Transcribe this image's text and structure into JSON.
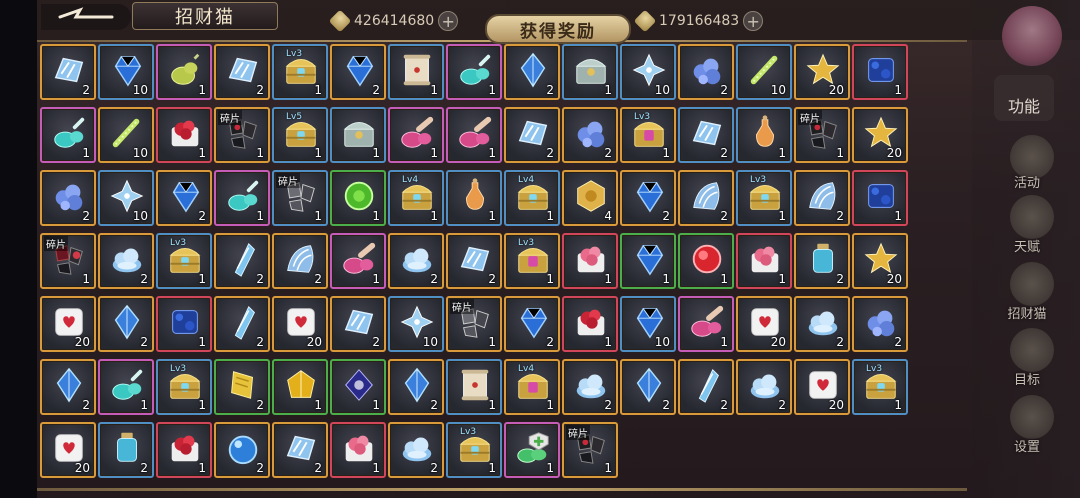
{
  "header": {
    "title": "招财猫",
    "currency_1": "426414680",
    "currency_2": "179166483",
    "reward_title": "获得奖励",
    "plus": "+"
  },
  "side_menu": {
    "function_label": "功能",
    "items": [
      {
        "label": "活动",
        "icon": "activity-emblem-icon"
      },
      {
        "label": "天赋",
        "icon": "talent-emblem-icon"
      },
      {
        "label": "招财猫",
        "icon": "lucky-cat-icon"
      },
      {
        "label": "目标",
        "icon": "target-icon"
      },
      {
        "label": "设置",
        "icon": "gear-icon"
      }
    ]
  },
  "rewards": [
    {
      "icon": "ice-crystal",
      "qty": "2",
      "rarity": "orange"
    },
    {
      "icon": "blue-gem",
      "qty": "10",
      "rarity": "blue"
    },
    {
      "icon": "potion-green",
      "qty": "1",
      "rarity": "purple"
    },
    {
      "icon": "ice-crystal",
      "qty": "2",
      "rarity": "orange"
    },
    {
      "icon": "chest",
      "qty": "1",
      "rarity": "blue",
      "lv": "Lv3"
    },
    {
      "icon": "blue-gem",
      "qty": "2",
      "rarity": "orange"
    },
    {
      "icon": "scroll",
      "qty": "1",
      "rarity": "blue"
    },
    {
      "icon": "potion-cyan",
      "qty": "1",
      "rarity": "purple"
    },
    {
      "icon": "blue-crystal",
      "qty": "2",
      "rarity": "orange"
    },
    {
      "icon": "chest-silver",
      "qty": "1",
      "rarity": "blue"
    },
    {
      "icon": "sparkle-crystal",
      "qty": "10",
      "rarity": "blue"
    },
    {
      "icon": "ore-blue",
      "qty": "2",
      "rarity": "orange"
    },
    {
      "icon": "wand",
      "qty": "10",
      "rarity": "blue"
    },
    {
      "icon": "star",
      "qty": "20",
      "rarity": "orange"
    },
    {
      "icon": "ore-dark",
      "qty": "1",
      "rarity": "red"
    },
    {
      "icon": "potion-cyan",
      "qty": "1",
      "rarity": "purple"
    },
    {
      "icon": "wand",
      "qty": "10",
      "rarity": "orange"
    },
    {
      "icon": "ore-red",
      "qty": "1",
      "rarity": "red"
    },
    {
      "icon": "shard-dark",
      "qty": "1",
      "rarity": "orange",
      "tag": "碎片"
    },
    {
      "icon": "chest",
      "qty": "1",
      "rarity": "blue",
      "lv": "Lv5"
    },
    {
      "icon": "chest-silver",
      "qty": "1",
      "rarity": "blue"
    },
    {
      "icon": "potion-pink",
      "qty": "1",
      "rarity": "purple"
    },
    {
      "icon": "potion-pink",
      "qty": "1",
      "rarity": "purple"
    },
    {
      "icon": "ice-crystal",
      "qty": "2",
      "rarity": "orange"
    },
    {
      "icon": "ore-blue",
      "qty": "2",
      "rarity": "orange"
    },
    {
      "icon": "chest-pink",
      "qty": "1",
      "rarity": "orange",
      "lv": "Lv3"
    },
    {
      "icon": "ice-crystal",
      "qty": "2",
      "rarity": "blue"
    },
    {
      "icon": "potion-orange",
      "qty": "1",
      "rarity": "blue"
    },
    {
      "icon": "shard-dark",
      "qty": "1",
      "rarity": "orange",
      "tag": "碎片"
    },
    {
      "icon": "star",
      "qty": "20",
      "rarity": "orange"
    },
    {
      "icon": "ore-blue",
      "qty": "2",
      "rarity": "orange"
    },
    {
      "icon": "sparkle-crystal",
      "qty": "10",
      "rarity": "blue"
    },
    {
      "icon": "blue-gem",
      "qty": "2",
      "rarity": "orange"
    },
    {
      "icon": "potion-cyan",
      "qty": "1",
      "rarity": "purple"
    },
    {
      "icon": "shard-grey",
      "qty": "1",
      "rarity": "blue",
      "tag": "碎片"
    },
    {
      "icon": "green-gem",
      "qty": "1",
      "rarity": "green"
    },
    {
      "icon": "chest",
      "qty": "1",
      "rarity": "blue",
      "lv": "Lv4"
    },
    {
      "icon": "potion-orange",
      "qty": "1",
      "rarity": "blue"
    },
    {
      "icon": "chest",
      "qty": "1",
      "rarity": "blue",
      "lv": "Lv4"
    },
    {
      "icon": "gold-emblem",
      "qty": "4",
      "rarity": "orange"
    },
    {
      "icon": "blue-gem",
      "qty": "2",
      "rarity": "orange"
    },
    {
      "icon": "wave-crystal",
      "qty": "2",
      "rarity": "orange"
    },
    {
      "icon": "chest",
      "qty": "1",
      "rarity": "blue",
      "lv": "Lv3"
    },
    {
      "icon": "wave-crystal",
      "qty": "2",
      "rarity": "orange"
    },
    {
      "icon": "ore-dark",
      "qty": "1",
      "rarity": "red"
    },
    {
      "icon": "shard-red",
      "qty": "1",
      "rarity": "orange",
      "tag": "碎片"
    },
    {
      "icon": "cloud-crystal",
      "qty": "2",
      "rarity": "orange"
    },
    {
      "icon": "chest",
      "qty": "1",
      "rarity": "blue",
      "lv": "Lv3"
    },
    {
      "icon": "shard-blue",
      "qty": "2",
      "rarity": "orange"
    },
    {
      "icon": "wave-crystal",
      "qty": "2",
      "rarity": "orange"
    },
    {
      "icon": "potion-pink",
      "qty": "1",
      "rarity": "purple"
    },
    {
      "icon": "cloud-crystal",
      "qty": "2",
      "rarity": "orange"
    },
    {
      "icon": "ice-crystal",
      "qty": "2",
      "rarity": "orange"
    },
    {
      "icon": "chest-pink",
      "qty": "1",
      "rarity": "orange",
      "lv": "Lv3"
    },
    {
      "icon": "ore-pink",
      "qty": "1",
      "rarity": "red"
    },
    {
      "icon": "blue-gem",
      "qty": "1",
      "rarity": "green"
    },
    {
      "icon": "red-gem",
      "qty": "1",
      "rarity": "green"
    },
    {
      "icon": "ore-pink",
      "qty": "1",
      "rarity": "red"
    },
    {
      "icon": "flask",
      "qty": "2",
      "rarity": "orange"
    },
    {
      "icon": "star",
      "qty": "20",
      "rarity": "orange"
    },
    {
      "icon": "dice",
      "qty": "20",
      "rarity": "orange"
    },
    {
      "icon": "blue-crystal",
      "qty": "2",
      "rarity": "orange"
    },
    {
      "icon": "ore-dark",
      "qty": "1",
      "rarity": "red"
    },
    {
      "icon": "shard-blue",
      "qty": "2",
      "rarity": "orange"
    },
    {
      "icon": "dice",
      "qty": "20",
      "rarity": "orange"
    },
    {
      "icon": "ice-crystal",
      "qty": "2",
      "rarity": "orange"
    },
    {
      "icon": "sparkle-crystal",
      "qty": "10",
      "rarity": "blue"
    },
    {
      "icon": "shard-grey",
      "qty": "1",
      "rarity": "orange",
      "tag": "碎片"
    },
    {
      "icon": "blue-gem",
      "qty": "2",
      "rarity": "orange"
    },
    {
      "icon": "ore-red",
      "qty": "1",
      "rarity": "red"
    },
    {
      "icon": "blue-gem",
      "qty": "10",
      "rarity": "blue"
    },
    {
      "icon": "potion-pink",
      "qty": "1",
      "rarity": "purple"
    },
    {
      "icon": "dice",
      "qty": "20",
      "rarity": "orange"
    },
    {
      "icon": "cloud-crystal",
      "qty": "2",
      "rarity": "orange"
    },
    {
      "icon": "ore-blue",
      "qty": "2",
      "rarity": "orange"
    },
    {
      "icon": "blue-crystal",
      "qty": "2",
      "rarity": "orange"
    },
    {
      "icon": "potion-cyan",
      "qty": "1",
      "rarity": "purple"
    },
    {
      "icon": "chest",
      "qty": "1",
      "rarity": "blue",
      "lv": "Lv3"
    },
    {
      "icon": "ticket",
      "qty": "2",
      "rarity": "green"
    },
    {
      "icon": "yellow-gem",
      "qty": "1",
      "rarity": "green"
    },
    {
      "icon": "dark-gem",
      "qty": "1",
      "rarity": "green"
    },
    {
      "icon": "blue-crystal",
      "qty": "2",
      "rarity": "orange"
    },
    {
      "icon": "scroll",
      "qty": "1",
      "rarity": "blue"
    },
    {
      "icon": "chest-pink",
      "qty": "1",
      "rarity": "orange",
      "lv": "Lv4"
    },
    {
      "icon": "cloud-crystal",
      "qty": "2",
      "rarity": "orange"
    },
    {
      "icon": "blue-crystal",
      "qty": "2",
      "rarity": "orange"
    },
    {
      "icon": "shard-blue",
      "qty": "2",
      "rarity": "orange"
    },
    {
      "icon": "cloud-crystal",
      "qty": "2",
      "rarity": "orange"
    },
    {
      "icon": "dice",
      "qty": "20",
      "rarity": "orange"
    },
    {
      "icon": "chest",
      "qty": "1",
      "rarity": "blue",
      "lv": "Lv3"
    },
    {
      "icon": "dice",
      "qty": "20",
      "rarity": "orange"
    },
    {
      "icon": "flask",
      "qty": "2",
      "rarity": "blue"
    },
    {
      "icon": "ore-red",
      "qty": "1",
      "rarity": "red"
    },
    {
      "icon": "blue-orb",
      "qty": "2",
      "rarity": "orange"
    },
    {
      "icon": "ice-crystal",
      "qty": "2",
      "rarity": "orange"
    },
    {
      "icon": "ore-pink",
      "qty": "1",
      "rarity": "red"
    },
    {
      "icon": "cloud-crystal",
      "qty": "2",
      "rarity": "orange"
    },
    {
      "icon": "chest",
      "qty": "1",
      "rarity": "blue",
      "lv": "Lv3"
    },
    {
      "icon": "potion-green-shield",
      "qty": "1",
      "rarity": "purple"
    },
    {
      "icon": "shard-dark",
      "qty": "1",
      "rarity": "orange",
      "tag": "碎片"
    }
  ],
  "colors": {
    "orange": "#d99a3b",
    "blue": "#4f8fc4",
    "purple": "#c45cb8",
    "red": "#d2465b",
    "green": "#4cae4a"
  }
}
